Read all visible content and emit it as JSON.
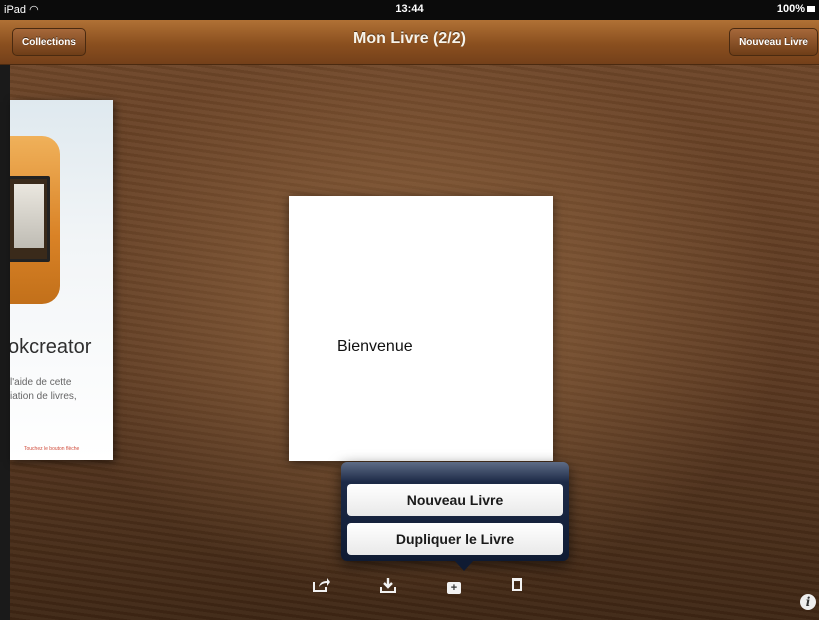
{
  "status_bar": {
    "carrier": "iPad",
    "time": "13:44",
    "battery": "100%"
  },
  "nav_bar": {
    "title": "Mon Livre (2/2)",
    "left_button": "Collections",
    "right_button": "Nouveau Livre"
  },
  "left_book_preview": {
    "title_fragment": "okcreator",
    "desc_line1": "l'aide de cette",
    "desc_line2": "iation de livres,",
    "hint": "Touchez le bouton flèche"
  },
  "current_page": {
    "text": "Bienvenue"
  },
  "popover": {
    "items": [
      "Nouveau Livre",
      "Dupliquer le Livre"
    ]
  },
  "toolbar": {
    "icons": [
      "share-icon",
      "download-icon",
      "add-book-icon",
      "trash-icon"
    ]
  },
  "colors": {
    "nav_bar": "#8a4f1f",
    "popover": "#0f1b33",
    "wood": "#5a3820"
  }
}
